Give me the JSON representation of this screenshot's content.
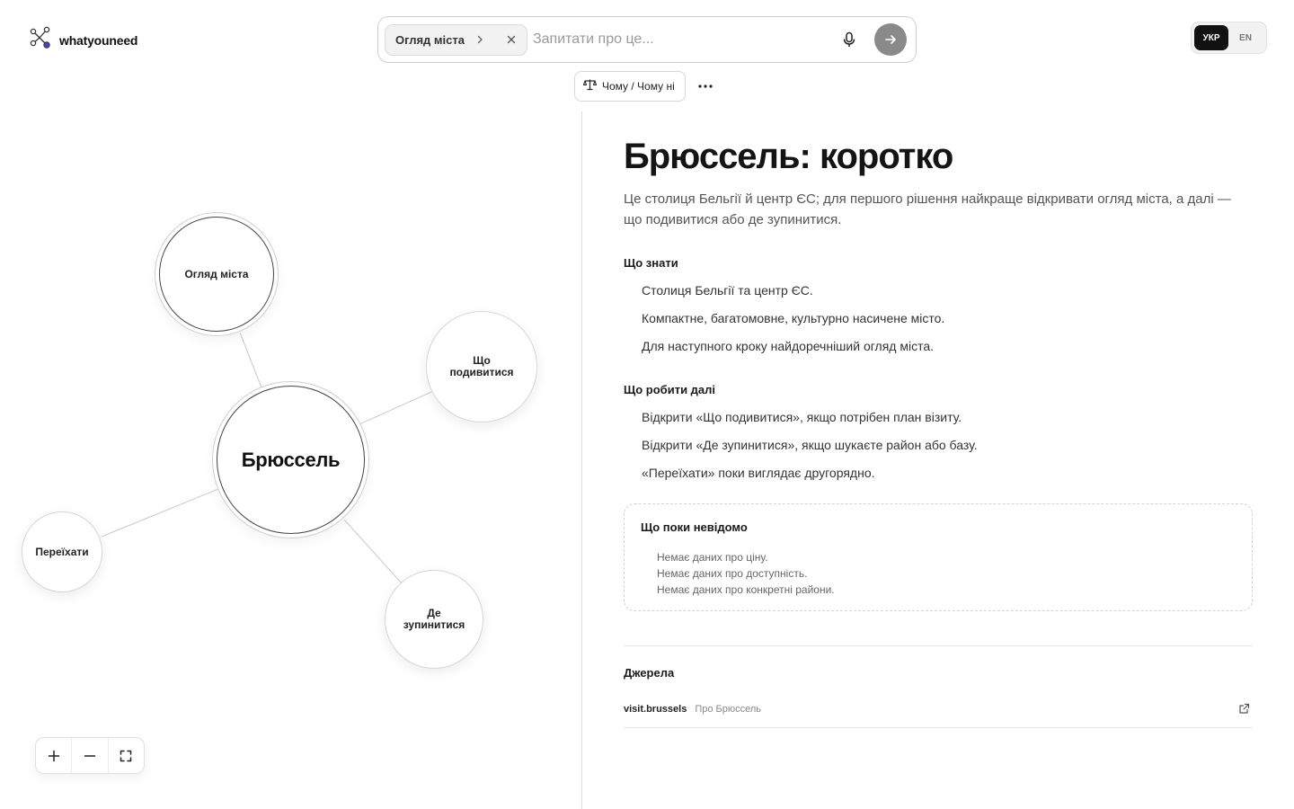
{
  "brand": {
    "name": "whatyouneed"
  },
  "search": {
    "chip_label": "Огляд міста",
    "placeholder": "Запитати про це...",
    "value": ""
  },
  "lang": {
    "options": [
      "УКР",
      "EN"
    ],
    "active": "УКР"
  },
  "why_pill": {
    "label": "Чому / Чому ні"
  },
  "graph": {
    "center": "Брюссель",
    "nodes": {
      "overview": "Огляд міста",
      "sights": "Що подивитися",
      "stay": "Де зупинитися",
      "move": "Переїхати"
    }
  },
  "article": {
    "title": "Брюссель: коротко",
    "intro": "Це столиця Бельгії й центр ЄС; для першого рішення найкраще відкривати огляд міста, а далі — що подивитися або де зупинитися.",
    "know": {
      "heading": "Що знати",
      "items": [
        "Столиця Бельгії та центр ЄС.",
        "Компактне, багатомовне, культурно насичене місто.",
        "Для наступного кроку найдоречніший огляд міста."
      ]
    },
    "next": {
      "heading": "Що робити далі",
      "items": [
        "Відкрити «Що подивитися», якщо потрібен план візиту.",
        "Відкрити «Де зупинитися», якщо шукаєте район або базу.",
        "«Переїхати» поки виглядає другорядно."
      ]
    },
    "unknown": {
      "heading": "Що поки невідомо",
      "items": [
        "Немає даних про ціну.",
        "Немає даних про доступність.",
        "Немає даних про конкретні райони."
      ]
    },
    "sources": {
      "heading": "Джерела",
      "items": [
        {
          "domain": "visit.brussels",
          "label": "Про Брюссель"
        }
      ]
    }
  },
  "icons": {
    "logo": "graph-network-icon",
    "chip_next": "chevron-right-icon",
    "chip_clear": "close-icon",
    "mic": "microphone-icon",
    "send": "arrow-right-icon",
    "why": "scales-icon",
    "more": "more-horizontal-icon",
    "zoom_in": "plus-icon",
    "zoom_out": "minus-icon",
    "fit": "fullscreen-icon",
    "external": "external-link-icon"
  },
  "colors": {
    "accent_dot": "#4b46b8",
    "send_button": "#8a8a8a",
    "active_lang_bg": "#111111"
  }
}
